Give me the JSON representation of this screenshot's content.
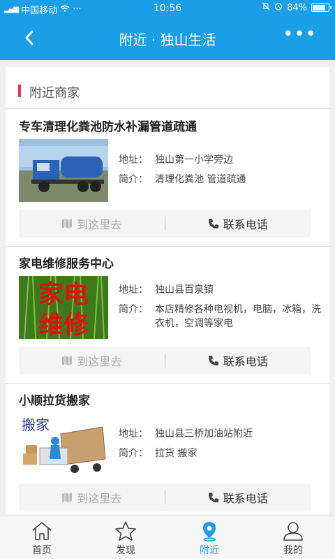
{
  "status": {
    "carrier": "中国移动",
    "time": "10:56",
    "battery": "84%",
    "battery_level": 0.84,
    "sig_label": "4G"
  },
  "header": {
    "title": "附近 · 独山生活",
    "back_icon": "chevron-left-icon",
    "more_icon": "more-dots-icon"
  },
  "section": {
    "title": "附近商家"
  },
  "listings": [
    {
      "name": "专车清理化粪池防水补漏管道疏通",
      "address_key": "地址：",
      "address": "独山第一小学旁边",
      "intro_key": "简介：",
      "intro": "清理化粪池 管道疏通",
      "go_label": "到这里去",
      "call_label": "联系电话"
    },
    {
      "name": "家电维修服务中心",
      "address_key": "地址：",
      "address": "独山县百泉镇",
      "intro_key": "简介：",
      "intro": "本店精修各种电视机，电脑，冰箱，洗衣机，空调等家电",
      "go_label": "到这里去",
      "call_label": "联系电话",
      "image_text_1": "家电",
      "image_text_2": "维修"
    },
    {
      "name": "小顺拉货搬家",
      "address_key": "地址：",
      "address": "独山县三桥加油站附近",
      "intro_key": "简介：",
      "intro": "拉货 搬家",
      "go_label": "到这里去",
      "call_label": "联系电话",
      "image_text_1": "搬家"
    }
  ],
  "tabs": [
    {
      "label": "首页",
      "icon": "home-icon"
    },
    {
      "label": "发现",
      "icon": "star-icon"
    },
    {
      "label": "附近",
      "icon": "location-pin-icon",
      "active": true
    },
    {
      "label": "我的",
      "icon": "user-icon"
    }
  ],
  "colors": {
    "primary": "#1a9ee8",
    "accent": "#e23b56"
  }
}
